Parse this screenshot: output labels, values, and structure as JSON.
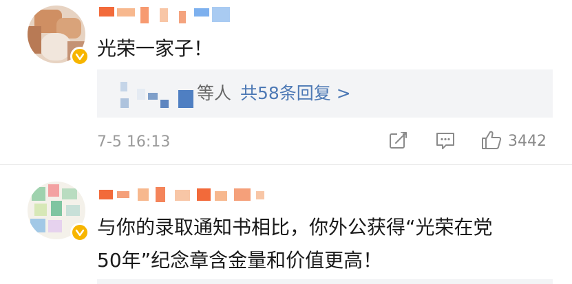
{
  "comments": [
    {
      "text": "光荣一家子！",
      "replies": {
        "suffix": "等人",
        "link": "共58条回复 >"
      },
      "timestamp": "7-5 16:13",
      "actions": {
        "repost_icon": "share-icon",
        "comment_icon": "comment-icon",
        "like_icon": "thumbs-up-icon",
        "like_count": "3442"
      }
    },
    {
      "text_line1": "与你的录取通知书相比，你外公获得“光荣在党",
      "text_line2": "50年”纪念章含金量和价值更高！"
    }
  ],
  "colors": {
    "verified_badge": "#f7b500",
    "reply_link": "#4d79b5",
    "reply_background": "#f3f4f6",
    "meta_text": "#9a9a9a"
  }
}
